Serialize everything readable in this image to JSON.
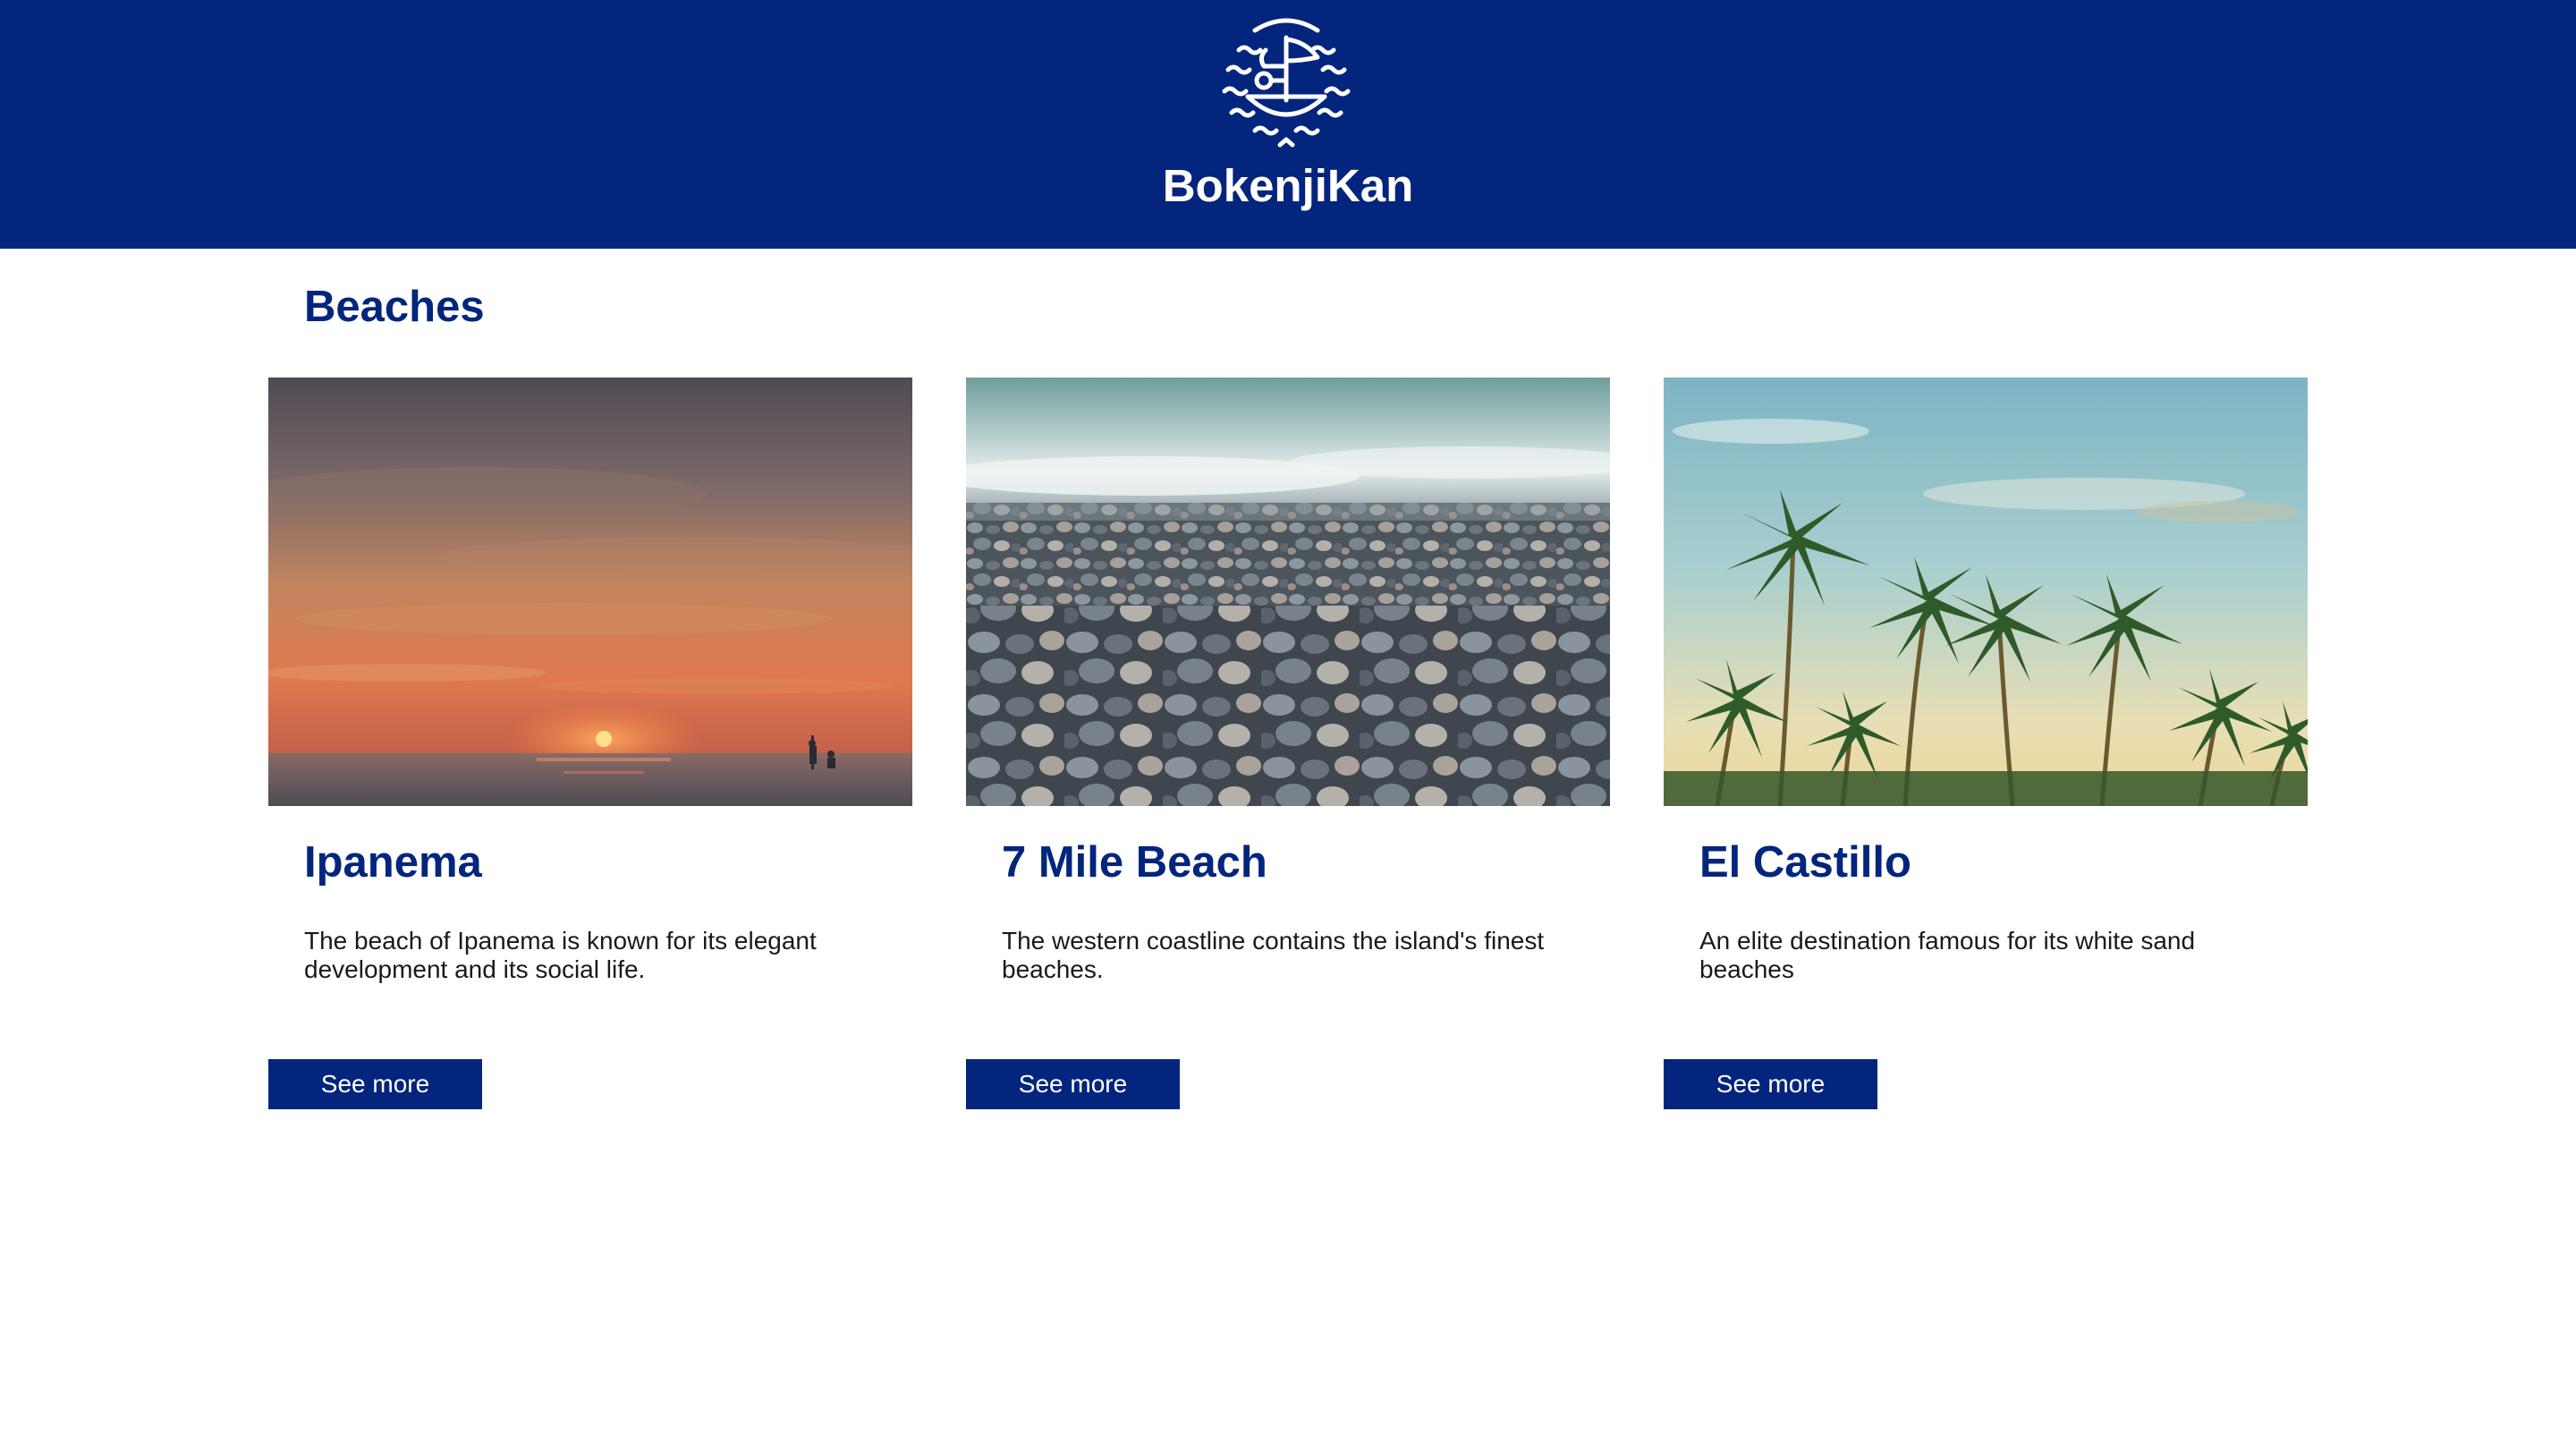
{
  "header": {
    "brand": "BokenjiKan",
    "logo_icon": "boat-waves-logo-icon",
    "background_color": "#03257d"
  },
  "section": {
    "title": "Beaches"
  },
  "cards": [
    {
      "title": "Ipanema",
      "description": "The beach of Ipanema is known for its elegant development and its social life.",
      "button_label": "See more",
      "image": "sunset-over-sea-photo"
    },
    {
      "title": "7 Mile Beach",
      "description": "The western coastline contains the island's finest beaches.",
      "button_label": "See more",
      "image": "pebble-beach-waves-photo"
    },
    {
      "title": "El Castillo",
      "description": "An elite destination famous for its white sand beaches",
      "button_label": "See more",
      "image": "palm-trees-sky-photo"
    }
  ],
  "colors": {
    "accent": "#03257d",
    "text": "#1a1a1a",
    "background": "#ffffff"
  }
}
